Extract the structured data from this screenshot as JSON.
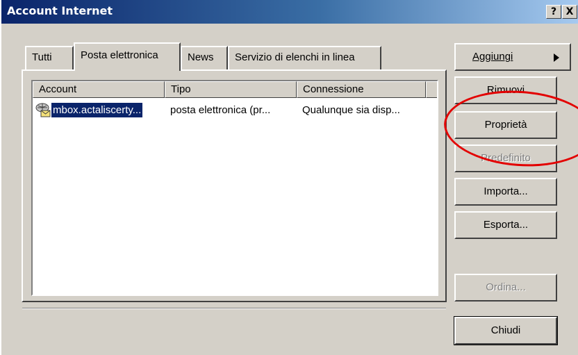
{
  "window": {
    "title": "Account Internet",
    "help_label": "?",
    "close_label": "X"
  },
  "tabs": [
    {
      "label": "Tutti"
    },
    {
      "label": "Posta elettronica"
    },
    {
      "label": "News"
    },
    {
      "label": "Servizio di elenchi in linea"
    }
  ],
  "list": {
    "columns": [
      "Account",
      "Tipo",
      "Connessione"
    ],
    "rows": [
      {
        "account": "mbox.actaliscerty...",
        "tipo": "posta elettronica (pr...",
        "connessione": "Qualunque sia disp..."
      }
    ]
  },
  "buttons": {
    "aggiungi": "Aggiungi",
    "rimuovi": "Rimuovi",
    "proprieta": "Proprietà",
    "predefinito": "Predefinito",
    "importa": "Importa...",
    "esporta": "Esporta...",
    "ordina": "Ordina...",
    "chiudi": "Chiudi"
  },
  "icons": {
    "account_icon": "mail-account-icon",
    "arrow": "triangle-right-icon"
  },
  "colors": {
    "selection": "#0a246a",
    "annotation_circle": "#e30000"
  }
}
